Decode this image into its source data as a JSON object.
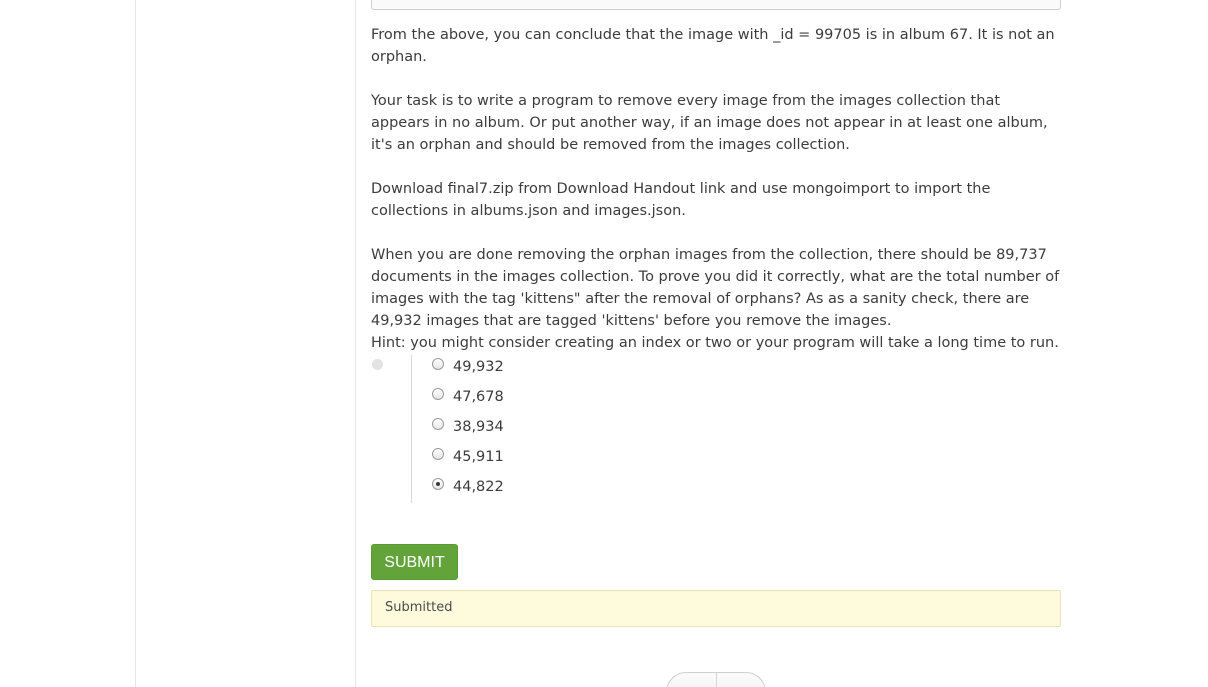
{
  "problem": {
    "paragraphs": [
      "From the above, you can conclude that the image with _id = 99705 is in album 67. It is not an orphan.",
      "Your task is to write a program to remove every image from the images collection that appears in no album. Or put another way, if an image does not appear in at least one album, it's an orphan and should be removed from the images collection.",
      "Download final7.zip from Download Handout link and use mongoimport to import the collections in albums.json and images.json.",
      "When you are done removing the orphan images from the collection, there should be 89,737 documents in the images collection. To prove you did it correctly, what are the total number of images with the tag 'kittens\" after the removal of orphans? As as a sanity check, there are 49,932 images that are tagged 'kittens' before you remove the images.",
      "Hint: you might consider creating an index or two or your program will take a long time to run."
    ],
    "choices": [
      {
        "label": "49,932",
        "checked": false
      },
      {
        "label": "47,678",
        "checked": false
      },
      {
        "label": "38,934",
        "checked": false
      },
      {
        "label": "45,911",
        "checked": false
      },
      {
        "label": "44,822",
        "checked": true
      }
    ],
    "submit_label": "SUBMIT",
    "status_message": "Submitted"
  },
  "colors": {
    "submit_button": "#62a43a",
    "status_background": "#fefbdc"
  },
  "icons": {
    "pager_prev": "chevron-left-icon",
    "pager_next": "chevron-right-icon"
  }
}
